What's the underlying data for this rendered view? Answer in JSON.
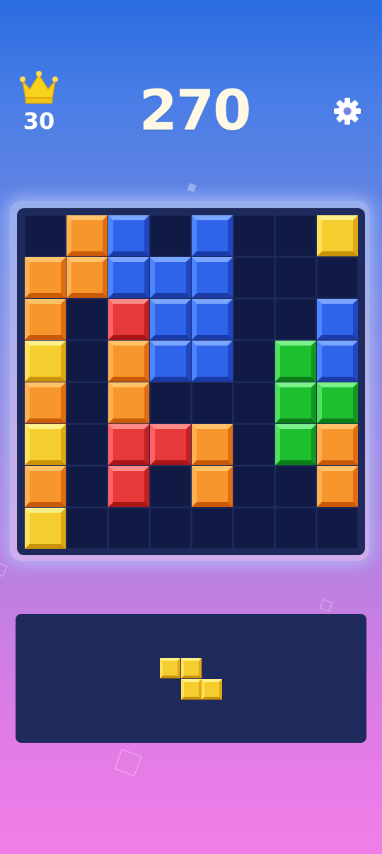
{
  "header": {
    "best_score": "30",
    "current_score": "270"
  },
  "icons": {
    "crown": "crown-icon",
    "settings": "gear-icon"
  },
  "colors": {
    "board": "#1e2a5c",
    "empty_cell": "#101a44",
    "orange": "#f7962c",
    "blue": "#2f64ea",
    "yellow": "#f5cd2e",
    "red": "#e63a3a",
    "green": "#1dbf2f"
  },
  "board": {
    "rows": 8,
    "cols": 8,
    "grid": [
      [
        "",
        "O",
        "B",
        "",
        "B",
        "",
        "",
        "Y"
      ],
      [
        "O",
        "O",
        "B",
        "B",
        "B",
        "",
        "",
        ""
      ],
      [
        "O",
        "",
        "R",
        "B",
        "B",
        "",
        "",
        "B"
      ],
      [
        "Y",
        "",
        "O",
        "B",
        "B",
        "",
        "G",
        "B"
      ],
      [
        "O",
        "",
        "O",
        "",
        "",
        "",
        "G",
        "G"
      ],
      [
        "Y",
        "",
        "R",
        "R",
        "O",
        "",
        "G",
        "O"
      ],
      [
        "O",
        "",
        "R",
        "",
        "O",
        "",
        "",
        "O"
      ],
      [
        "Y",
        "",
        "",
        "",
        "",
        "",
        "",
        ""
      ]
    ]
  },
  "tray": {
    "pieces": [
      {
        "color": "Y",
        "cells": [
          [
            0,
            0
          ],
          [
            0,
            1
          ],
          [
            1,
            1
          ],
          [
            1,
            2
          ]
        ]
      }
    ]
  }
}
